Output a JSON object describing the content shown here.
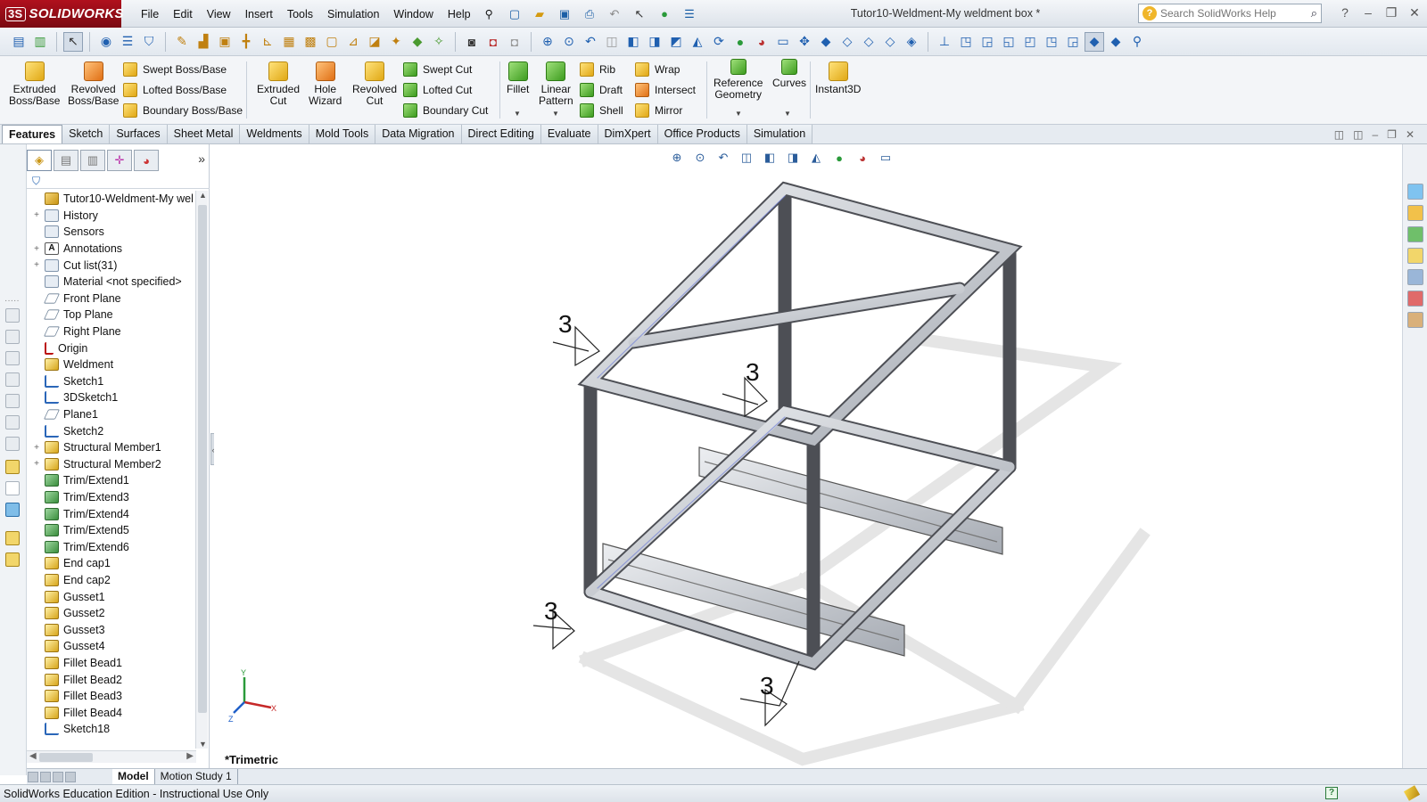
{
  "app": {
    "logo_text": "SOLIDWORKS",
    "logo_mark": "3S"
  },
  "menu": [
    "File",
    "Edit",
    "View",
    "Insert",
    "Tools",
    "Simulation",
    "Window",
    "Help"
  ],
  "document_title": "Tutor10-Weldment-My weldment box *",
  "search": {
    "placeholder": "Search SolidWorks Help"
  },
  "ribbon": {
    "extruded_boss": "Extruded\nBoss/Base",
    "revolved_boss": "Revolved\nBoss/Base",
    "swept_boss": "Swept Boss/Base",
    "lofted_boss": "Lofted Boss/Base",
    "boundary_boss": "Boundary Boss/Base",
    "extruded_cut": "Extruded\nCut",
    "hole_wizard": "Hole\nWizard",
    "revolved_cut": "Revolved\nCut",
    "swept_cut": "Swept Cut",
    "lofted_cut": "Lofted Cut",
    "boundary_cut": "Boundary Cut",
    "fillet": "Fillet",
    "linear_pattern": "Linear\nPattern",
    "rib": "Rib",
    "draft": "Draft",
    "shell": "Shell",
    "wrap": "Wrap",
    "intersect": "Intersect",
    "mirror": "Mirror",
    "reference_geometry": "Reference\nGeometry",
    "curves": "Curves",
    "instant3d": "Instant3D"
  },
  "command_tabs": [
    "Features",
    "Sketch",
    "Surfaces",
    "Sheet Metal",
    "Weldments",
    "Mold Tools",
    "Data Migration",
    "Direct Editing",
    "Evaluate",
    "DimXpert",
    "Office Products",
    "Simulation"
  ],
  "feature_tree": {
    "filter_icon": "funnel-icon",
    "items": [
      {
        "label": "Tutor10-Weldment-My wel",
        "icon": "part",
        "expander": ""
      },
      {
        "label": "History",
        "icon": "fold",
        "expander": "+"
      },
      {
        "label": "Sensors",
        "icon": "fold",
        "expander": ""
      },
      {
        "label": "Annotations",
        "icon": "ann",
        "expander": "+"
      },
      {
        "label": "Cut list(31)",
        "icon": "fold",
        "expander": "+"
      },
      {
        "label": "Material <not specified>",
        "icon": "fold",
        "expander": ""
      },
      {
        "label": "Front Plane",
        "icon": "plane",
        "expander": ""
      },
      {
        "label": "Top Plane",
        "icon": "plane",
        "expander": ""
      },
      {
        "label": "Right Plane",
        "icon": "plane",
        "expander": ""
      },
      {
        "label": "Origin",
        "icon": "red",
        "expander": ""
      },
      {
        "label": "Weldment",
        "icon": "feat",
        "expander": ""
      },
      {
        "label": "Sketch1",
        "icon": "sk",
        "expander": ""
      },
      {
        "label": "3DSketch1",
        "icon": "sk",
        "expander": ""
      },
      {
        "label": "Plane1",
        "icon": "plane",
        "expander": ""
      },
      {
        "label": "Sketch2",
        "icon": "sk",
        "expander": ""
      },
      {
        "label": "Structural Member1",
        "icon": "feat",
        "expander": "+"
      },
      {
        "label": "Structural Member2",
        "icon": "feat",
        "expander": "+"
      },
      {
        "label": "Trim/Extend1",
        "icon": "trim",
        "expander": ""
      },
      {
        "label": "Trim/Extend3",
        "icon": "trim",
        "expander": ""
      },
      {
        "label": "Trim/Extend4",
        "icon": "trim",
        "expander": ""
      },
      {
        "label": "Trim/Extend5",
        "icon": "trim",
        "expander": ""
      },
      {
        "label": "Trim/Extend6",
        "icon": "trim",
        "expander": ""
      },
      {
        "label": "End cap1",
        "icon": "feat",
        "expander": ""
      },
      {
        "label": "End cap2",
        "icon": "feat",
        "expander": ""
      },
      {
        "label": "Gusset1",
        "icon": "feat",
        "expander": ""
      },
      {
        "label": "Gusset2",
        "icon": "feat",
        "expander": ""
      },
      {
        "label": "Gusset3",
        "icon": "feat",
        "expander": ""
      },
      {
        "label": "Gusset4",
        "icon": "feat",
        "expander": ""
      },
      {
        "label": "Fillet Bead1",
        "icon": "feat",
        "expander": ""
      },
      {
        "label": "Fillet Bead2",
        "icon": "feat",
        "expander": ""
      },
      {
        "label": "Fillet Bead3",
        "icon": "feat",
        "expander": ""
      },
      {
        "label": "Fillet Bead4",
        "icon": "feat",
        "expander": ""
      },
      {
        "label": "Sketch18",
        "icon": "sk",
        "expander": ""
      }
    ]
  },
  "viewport": {
    "view_name": "*Trimetric",
    "weld_labels": [
      "3",
      "3",
      "3",
      "3"
    ],
    "triad": {
      "x": "X",
      "y": "Y",
      "z": "Z"
    }
  },
  "bottom_tabs": [
    "Model",
    "Motion Study 1"
  ],
  "status": {
    "text": "SolidWorks Education Edition - Instructional Use Only"
  },
  "colors": {
    "logo_red": "#b0101d",
    "accent_blue": "#2060b0",
    "steel": "#c9ccd1"
  }
}
